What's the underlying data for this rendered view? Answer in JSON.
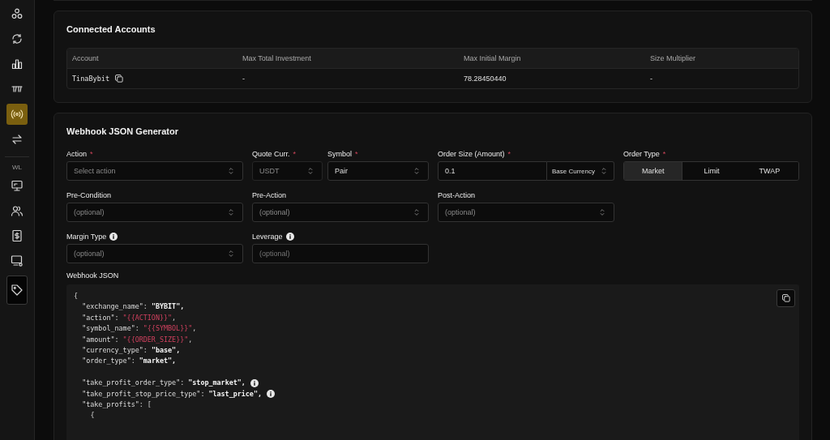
{
  "sidebar": {
    "top_items": [
      {
        "selected": false,
        "focused": false
      },
      {
        "selected": false,
        "focused": false
      },
      {
        "selected": false,
        "focused": false
      },
      {
        "selected": false,
        "focused": false
      },
      {
        "selected": true,
        "focused": false
      },
      {
        "selected": false,
        "focused": false
      }
    ],
    "section_label": "WL",
    "bottom_items": [
      {
        "selected": false,
        "focused": false
      },
      {
        "selected": false,
        "focused": false
      },
      {
        "selected": false,
        "focused": false
      },
      {
        "selected": false,
        "focused": false
      },
      {
        "selected": false,
        "focused": true
      }
    ]
  },
  "connected_accounts": {
    "title": "Connected Accounts",
    "columns": [
      "Account",
      "Max Total Investment",
      "Max Initial Margin",
      "Size Multiplier"
    ],
    "rows": [
      {
        "cells": [
          "TinaBybit",
          "-",
          "78.28450440",
          "-"
        ]
      }
    ]
  },
  "generator": {
    "title": "Webhook JSON Generator",
    "rows": [
      [
        {
          "kind": "select",
          "label": "Action",
          "required_mark": "*",
          "placeholder": "Select action"
        },
        {
          "kind": "pair",
          "fields": [
            {
              "kind": "select",
              "label": "Quote Curr.",
              "required_mark": "*",
              "value": "USDT",
              "disabled": true
            },
            {
              "kind": "select",
              "label": "Symbol",
              "required_mark": "*",
              "value": "Pair",
              "disabled": false
            }
          ]
        },
        {
          "kind": "input-select",
          "label": "Order Size (Amount)",
          "required_mark": "*",
          "value": "0.1",
          "unit": "Base Currency"
        },
        {
          "kind": "segmented",
          "label": "Order Type",
          "required_mark": "*",
          "options": [
            {
              "label": "Market",
              "selected": true
            },
            {
              "label": "Limit",
              "selected": false
            },
            {
              "label": "TWAP",
              "selected": false
            }
          ]
        }
      ],
      [
        {
          "kind": "select",
          "label": "Pre-Condition",
          "placeholder": "(optional)"
        },
        {
          "kind": "select",
          "label": "Pre-Action",
          "placeholder": "(optional)"
        },
        {
          "kind": "select",
          "label": "Post-Action",
          "placeholder": "(optional)"
        }
      ],
      [
        {
          "kind": "select",
          "label": "Margin Type",
          "info": true,
          "placeholder": "(optional)"
        },
        {
          "kind": "input",
          "label": "Leverage",
          "info": true,
          "placeholder": "(optional)"
        }
      ]
    ],
    "json_label": "Webhook JSON",
    "code": [
      {
        "kind": "code",
        "parts": [
          {
            "kind": "punct",
            "t": "{"
          }
        ],
        "children": [
          {
            "kind": "code",
            "parts": [
              {
                "kind": "key",
                "t": "\"exchange_name\":"
              },
              {
                "kind": "value",
                "t": "\"BYBIT\","
              }
            ]
          },
          {
            "kind": "code",
            "parts": [
              {
                "kind": "key",
                "t": "\"action\":"
              },
              {
                "kind": "template",
                "t": "\"{{ACTION}}\""
              },
              {
                "kind": "punct",
                "t": ","
              }
            ]
          },
          {
            "kind": "code",
            "parts": [
              {
                "kind": "key",
                "t": "\"symbol_name\":"
              },
              {
                "kind": "template",
                "t": "\"{{SYMBOL}}\""
              },
              {
                "kind": "punct",
                "t": ","
              }
            ]
          },
          {
            "kind": "code",
            "parts": [
              {
                "kind": "key",
                "t": "\"amount\":"
              },
              {
                "kind": "template",
                "t": "\"{{ORDER_SIZE}}\""
              },
              {
                "kind": "punct",
                "t": ","
              }
            ]
          },
          {
            "kind": "code",
            "parts": [
              {
                "kind": "key",
                "t": "\"currency_type\":"
              },
              {
                "kind": "value",
                "t": "\"base\","
              }
            ]
          },
          {
            "kind": "code",
            "parts": [
              {
                "kind": "key",
                "t": "\"order_type\":"
              },
              {
                "kind": "value",
                "t": "\"market\","
              }
            ]
          },
          {
            "kind": "blank"
          },
          {
            "kind": "code",
            "info": true,
            "parts": [
              {
                "kind": "key",
                "t": "\"take_profit_order_type\":"
              },
              {
                "kind": "value",
                "t": "\"stop_market\","
              }
            ]
          },
          {
            "kind": "code",
            "info": true,
            "parts": [
              {
                "kind": "key",
                "t": "\"take_profit_stop_price_type\":"
              },
              {
                "kind": "value",
                "t": "\"last_price\","
              }
            ]
          },
          {
            "kind": "code",
            "parts": [
              {
                "kind": "key",
                "t": "\"take_profits\":"
              },
              {
                "kind": "punct",
                "t": "["
              }
            ],
            "children": [
              {
                "kind": "code",
                "parts": [
                  {
                    "kind": "punct",
                    "t": "{"
                  }
                ]
              }
            ]
          }
        ]
      }
    ]
  }
}
